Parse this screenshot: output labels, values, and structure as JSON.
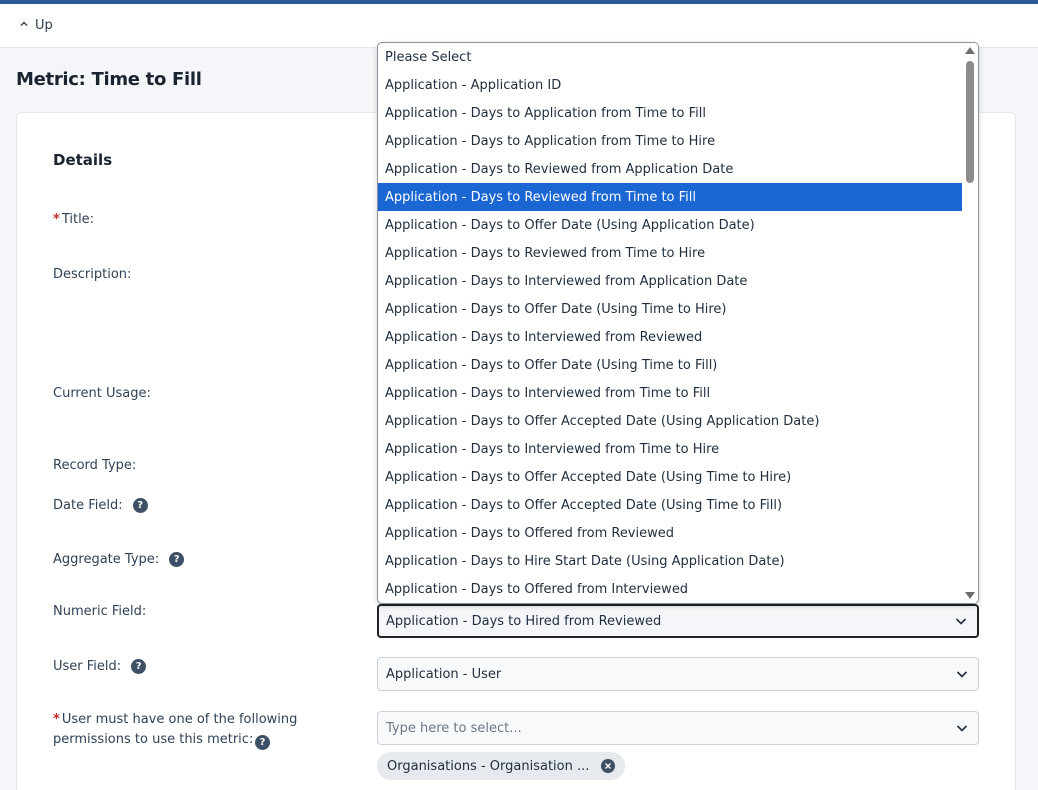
{
  "topbar": {
    "up_label": "Up"
  },
  "page": {
    "title": "Metric: Time to Fill"
  },
  "details": {
    "section_title": "Details",
    "title_label": "Title:",
    "description_label": "Description:",
    "current_usage_label": "Current Usage:",
    "record_type_label": "Record Type:",
    "date_field_label": "Date Field:",
    "aggregate_type_label": "Aggregate Type:",
    "numeric_field_label": "Numeric Field:",
    "user_field_label": "User Field:",
    "permissions_label_line1": "User must have one of the following",
    "permissions_label_line2": "permissions to use this metric:",
    "required_marker": "*",
    "help_glyph": "?"
  },
  "numeric_field": {
    "value": "Application - Days to Hired from Reviewed"
  },
  "user_field": {
    "value": "Application - User"
  },
  "permissions": {
    "placeholder": "Type here to select...",
    "chips": [
      "Organisations - Organisation ..."
    ]
  },
  "dropdown": {
    "options": [
      "Please Select",
      "Application - Application ID",
      "Application - Days to Application from Time to Fill",
      "Application - Days to Application from Time to Hire",
      "Application - Days to Reviewed from Application Date",
      "Application - Days to Reviewed from Time to Fill",
      "Application - Days to Offer Date (Using Application Date)",
      "Application - Days to Reviewed from Time to Hire",
      "Application - Days to Interviewed from Application Date",
      "Application - Days to Offer Date (Using Time to Hire)",
      "Application - Days to Interviewed from Reviewed",
      "Application - Days to Offer Date (Using Time to Fill)",
      "Application - Days to Interviewed from Time to Fill",
      "Application - Days to Offer Accepted Date (Using Application Date)",
      "Application - Days to Interviewed from Time to Hire",
      "Application - Days to Offer Accepted Date (Using Time to Hire)",
      "Application - Days to Offer Accepted Date (Using Time to Fill)",
      "Application - Days to Offered from Reviewed",
      "Application - Days to Hire Start Date (Using Application Date)",
      "Application - Days to Offered from Interviewed"
    ],
    "highlighted_index": 5
  },
  "colors": {
    "accent": "#2a5b93",
    "highlight": "#1a66d2",
    "required": "#c62828"
  }
}
